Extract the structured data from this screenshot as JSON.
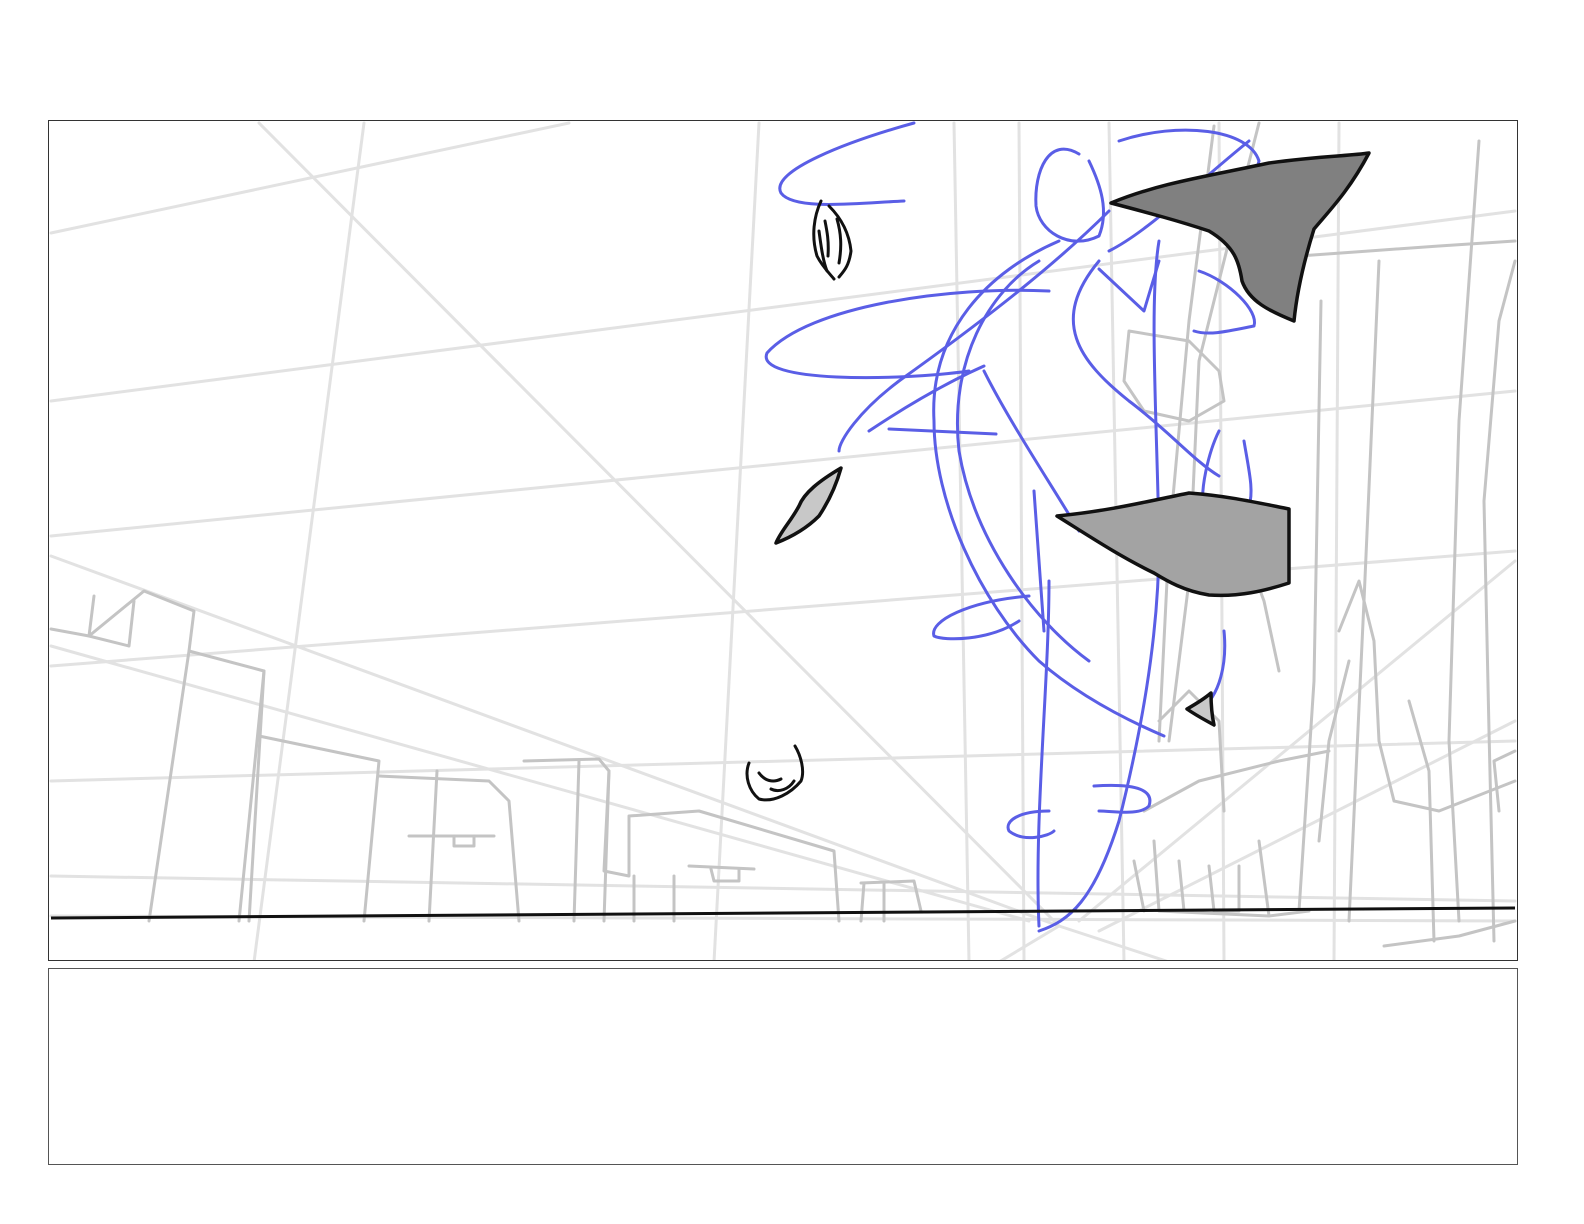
{
  "panel": {
    "notes_text": "",
    "colors": {
      "grid": "#e2e2e2",
      "buildings": "#c4c4c4",
      "figure_rough": "#5a5ee6",
      "ink": "#111111",
      "fill_dark": "#808080",
      "fill_mid": "#a3a3a3",
      "fill_light": "#c8c8c8"
    }
  }
}
